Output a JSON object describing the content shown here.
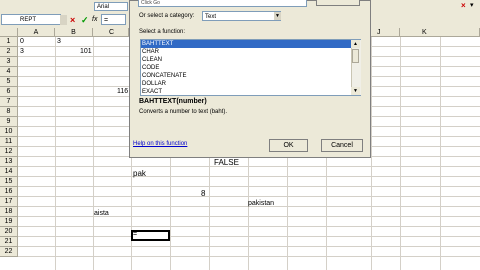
{
  "toolbar": {
    "name_box": "REPT",
    "font_name": "Arial",
    "formula_input": "=",
    "cancel_icon": "×",
    "enter_icon": "✓",
    "fx_label": "fx"
  },
  "columns": [
    "A",
    "B",
    "C",
    "J",
    "K"
  ],
  "rows": [
    "1",
    "2",
    "3",
    "4",
    "5",
    "6",
    "7",
    "8",
    "9",
    "10",
    "11",
    "12",
    "13",
    "14",
    "15",
    "16",
    "17",
    "18",
    "19",
    "20",
    "21",
    "22"
  ],
  "cells": {
    "a1": "0",
    "b1": "3",
    "a2": "3",
    "b2": "101",
    "c6": "116",
    "false13": "FALSE",
    "pak14": "pak",
    "eight16": "8",
    "pakistan17": "pakistan",
    "aista18": "aista",
    "active20": "="
  },
  "dialog": {
    "search_text": "Click Go",
    "category_label": "Or select a category:",
    "category_value": "Text",
    "function_label": "Select a function:",
    "functions": [
      "BAHTTEXT",
      "CHAR",
      "CLEAN",
      "CODE",
      "CONCATENATE",
      "DOLLAR",
      "EXACT"
    ],
    "selected_index": 0,
    "syntax": "BAHTTEXT(number)",
    "description": "Converts a number to text (baht).",
    "help_link": "Help on this function",
    "ok_label": "OK",
    "cancel_label": "Cancel"
  }
}
